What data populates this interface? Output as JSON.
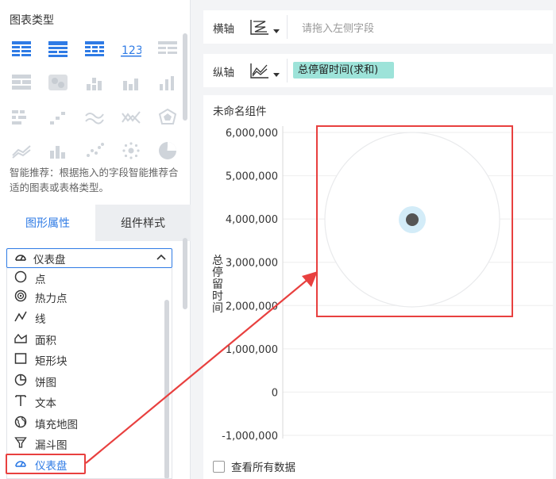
{
  "left_panel": {
    "chart_types_title": "图表类型",
    "smart_tip": "智能推荐：根据拖入的字段智能推荐合适的图表或表格类型。",
    "tabs": [
      {
        "label": "图形属性",
        "active": true
      },
      {
        "label": "组件样式",
        "active": false
      }
    ],
    "select": {
      "selected_label": "仪表盘",
      "icon": "gauge-icon"
    },
    "dropdown_items": [
      {
        "label": "点",
        "icon": "circle-icon"
      },
      {
        "label": "热力点",
        "icon": "heat-point-icon"
      },
      {
        "label": "线",
        "icon": "line-icon"
      },
      {
        "label": "面积",
        "icon": "area-icon"
      },
      {
        "label": "矩形块",
        "icon": "rectangle-icon"
      },
      {
        "label": "饼图",
        "icon": "pie-icon"
      },
      {
        "label": "文本",
        "icon": "text-icon"
      },
      {
        "label": "填充地图",
        "icon": "globe-icon"
      },
      {
        "label": "漏斗图",
        "icon": "funnel-icon"
      },
      {
        "label": "仪表盘",
        "icon": "gauge-icon",
        "selected": true
      }
    ]
  },
  "axes": {
    "x": {
      "label": "横轴",
      "placeholder": "请拖入左侧字段"
    },
    "y": {
      "label": "纵轴",
      "field": "总停留时间(求和)"
    }
  },
  "chart": {
    "title": "未命名组件",
    "view_all_label": "查看所有数据"
  },
  "chart_data": {
    "type": "scatter",
    "ylabel": "总停留时间",
    "yticks": [
      "6,000,000",
      "5,000,000",
      "4,000,000",
      "3,000,000",
      "2,000,000",
      "1,000,000",
      "0",
      "-1,000,000"
    ],
    "ylim": [
      -1000000,
      6000000
    ],
    "grid": true
  },
  "colors": {
    "accent": "#2f7be5",
    "annotation_red": "#e8403f",
    "chip": "#9de3d9"
  }
}
